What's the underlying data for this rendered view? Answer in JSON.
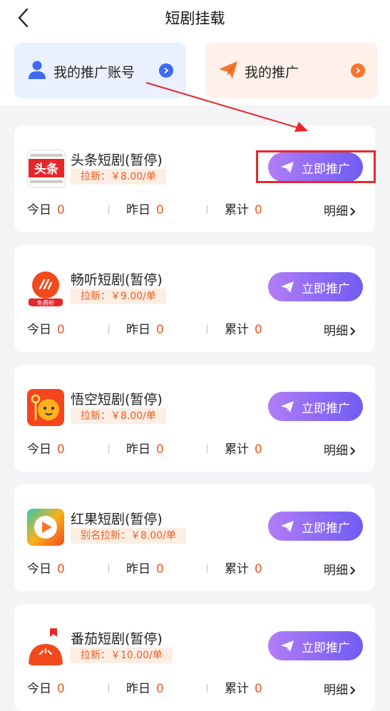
{
  "header": {
    "title": "短剧挂载"
  },
  "top_cards": {
    "account_label": "我的推广账号",
    "promo_label": "我的推广"
  },
  "cards": [
    {
      "name": "头条短剧(暂停)",
      "tag": "拉新：￥8.00/单",
      "button": "立即推广",
      "stats": {
        "today_label": "今日",
        "today": "0",
        "yesterday_label": "昨日",
        "yesterday": "0",
        "total_label": "累计",
        "total": "0"
      },
      "detail": "明细",
      "logo_text": "头条"
    },
    {
      "name": "畅听短剧(暂停)",
      "tag": "拉新：￥9.00/单",
      "button": "立即推广",
      "stats": {
        "today_label": "今日",
        "today": "0",
        "yesterday_label": "昨日",
        "yesterday": "0",
        "total_label": "累计",
        "total": "0"
      },
      "detail": "明细",
      "logo_text": "免费听"
    },
    {
      "name": "悟空短剧(暂停)",
      "tag": "拉新：￥8.00/单",
      "button": "立即推广",
      "stats": {
        "today_label": "今日",
        "today": "0",
        "yesterday_label": "昨日",
        "yesterday": "0",
        "total_label": "累计",
        "total": "0"
      },
      "detail": "明细"
    },
    {
      "name": "红果短剧(暂停)",
      "tag": "别名拉新：￥8.00/单",
      "button": "立即推广",
      "stats": {
        "today_label": "今日",
        "today": "0",
        "yesterday_label": "昨日",
        "yesterday": "0",
        "total_label": "累计",
        "total": "0"
      },
      "detail": "明细"
    },
    {
      "name": "番茄短剧(暂停)",
      "tag": "拉新：￥10.00/单",
      "button": "立即推广",
      "stats": {
        "today_label": "今日",
        "today": "0",
        "yesterday_label": "昨日",
        "yesterday": "0",
        "total_label": "累计",
        "total": "0"
      },
      "detail": "明细"
    }
  ],
  "colors": {
    "accent_orange": "#f15a20",
    "button_start": "#b27df6",
    "button_end": "#6f5cf2",
    "annotation_red": "#e8262a"
  }
}
